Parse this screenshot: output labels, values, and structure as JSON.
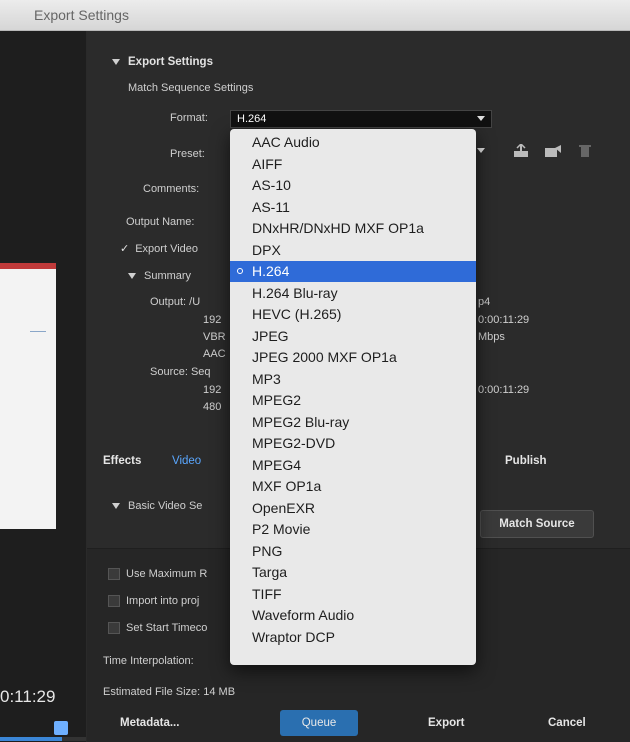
{
  "window": {
    "title": "Export Settings"
  },
  "left_pane": {
    "timecode": "0:11:29"
  },
  "export_settings": {
    "section_label": "Export Settings",
    "match_sequence": "Match Sequence Settings",
    "format_label": "Format:",
    "format_value": "H.264",
    "preset_label": "Preset:",
    "comments_label": "Comments:",
    "output_name_label": "Output Name:",
    "export_video": "Export Video",
    "summary_label": "Summary",
    "output_label": "Output: /U",
    "output_right_1": "p4",
    "output_right_2": "0:00:11:29",
    "output_right_3": "Mbps",
    "output_left_1": "192",
    "output_left_2": "VBR",
    "output_left_3": "AAC",
    "source_label": "Source: Seq",
    "source_left_1": "192",
    "source_left_2": "480",
    "source_right_1": "0:00:11:29"
  },
  "format_dropdown": {
    "items": [
      "AAC Audio",
      "AIFF",
      "AS-10",
      "AS-11",
      "DNxHR/DNxHD MXF OP1a",
      "DPX",
      "H.264",
      "H.264 Blu-ray",
      "HEVC (H.265)",
      "JPEG",
      "JPEG 2000 MXF OP1a",
      "MP3",
      "MPEG2",
      "MPEG2 Blu-ray",
      "MPEG2-DVD",
      "MPEG4",
      "MXF OP1a",
      "OpenEXR",
      "P2 Movie",
      "PNG",
      "Targa",
      "TIFF",
      "Waveform Audio",
      "Wraptor DCP"
    ],
    "selected": "H.264"
  },
  "tabs": {
    "effects": "Effects",
    "video": "Video",
    "publish": "Publish"
  },
  "basic_video": {
    "label": "Basic Video Se",
    "match_source": "Match Source"
  },
  "options": {
    "use_max": "Use Maximum R",
    "import_project": "Import into proj",
    "set_start": "Set Start Timeco",
    "time_interp": "Time Interpolation:",
    "file_size": "Estimated File Size:  14 MB"
  },
  "footer": {
    "metadata": "Metadata...",
    "queue": "Queue",
    "export": "Export",
    "cancel": "Cancel"
  },
  "colors": {
    "accent": "#2f6bd8",
    "queue": "#2a6fb0"
  }
}
